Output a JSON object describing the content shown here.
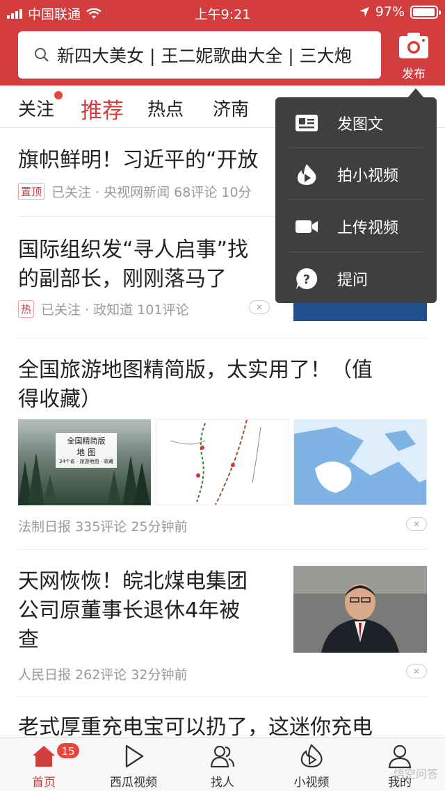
{
  "status_bar": {
    "carrier": "中国联通",
    "time": "上午9:21",
    "battery": "97%",
    "battery_level": 0.97
  },
  "search": {
    "query": "新四大美女 | 王二妮歌曲大全 | 三大炮"
  },
  "publish": {
    "label": "发布"
  },
  "tabs": [
    "关注",
    "推荐",
    "热点",
    "济南"
  ],
  "active_tab": "推荐",
  "dropdown": {
    "items": [
      {
        "label": "发图文",
        "icon": "image-text-icon"
      },
      {
        "label": "拍小视频",
        "icon": "small-video-icon"
      },
      {
        "label": "上传视频",
        "icon": "video-camera-icon"
      },
      {
        "label": "提问",
        "icon": "question-icon"
      }
    ]
  },
  "feed": {
    "items": [
      {
        "title": "旗帜鲜明！习近平的“开放",
        "tag": "置顶",
        "meta": "已关注 · 央视网新闻  68评论  10分"
      },
      {
        "title_line1": "国际组织发“寻人启事”找",
        "title_line2": "的副部长，刚刚落马了",
        "tag": "热",
        "meta": "已关注 · 政知道  101评论"
      },
      {
        "title_line1": "全国旅游地图精简版，太实用了！（值",
        "title_line2": "得收藏）",
        "thumb_title": "全国精简版",
        "thumb_sub": "地 图",
        "thumb_caption": "34个省 · 旅游地图 · 收藏",
        "meta": "法制日报  335评论  25分钟前"
      },
      {
        "title_line1": "天网恢恢！皖北煤电集团",
        "title_line2": "公司原董事长退休4年被",
        "title_line3": "查",
        "meta": "人民日报  262评论  32分钟前"
      },
      {
        "title": "老式厚重充电宝可以扔了，这迷你充电"
      }
    ]
  },
  "bottom_nav": [
    {
      "label": "首页",
      "icon": "home-icon",
      "badge": "15"
    },
    {
      "label": "西瓜视频",
      "icon": "play-icon"
    },
    {
      "label": "找人",
      "icon": "people-icon"
    },
    {
      "label": "小视频",
      "icon": "small-video-icon"
    },
    {
      "label": "我的",
      "icon": "user-icon"
    }
  ],
  "watermark": "悟空问答",
  "colors": {
    "brand_red": "#d43d3d",
    "dropdown_bg": "#3f3f3f"
  }
}
